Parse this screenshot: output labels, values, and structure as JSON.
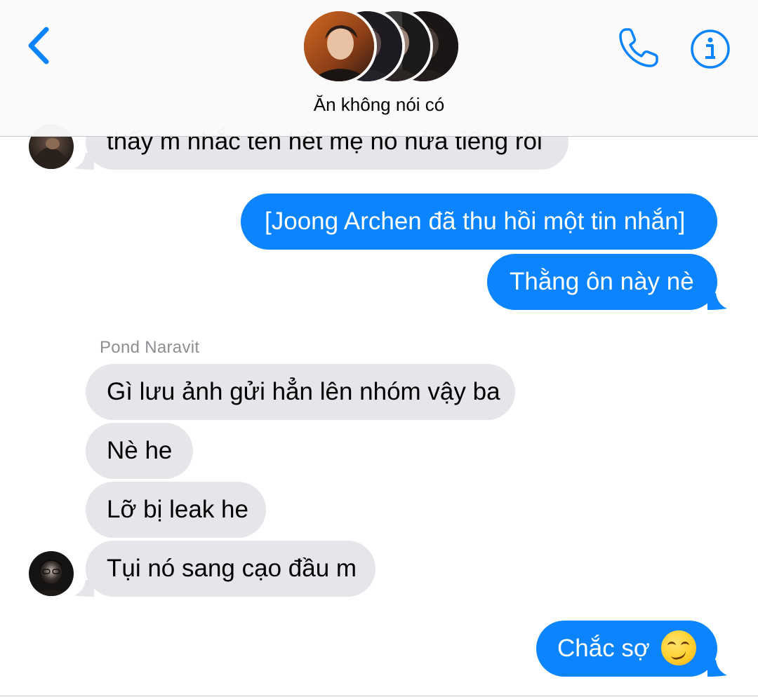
{
  "header": {
    "title": "Ăn không nói có",
    "accent_color": "#0b84fe",
    "icons": {
      "back": "chevron-left-icon",
      "call": "phone-icon",
      "info": "info-icon"
    }
  },
  "messages": [
    {
      "direction": "incoming",
      "text": "thấy m nhắc tên hết mẹ nó nửa tiếng rồi"
    },
    {
      "direction": "outgoing",
      "text": "[Joong Archen đã thu hồi một tin nhắn]"
    },
    {
      "direction": "outgoing",
      "text": "Thằng ôn này nè"
    },
    {
      "direction": "incoming",
      "sender": "Pond Naravit",
      "text": "Gì lưu ảnh gửi hẳn lên nhóm vậy ba"
    },
    {
      "direction": "incoming",
      "text": "Nè he"
    },
    {
      "direction": "incoming",
      "text": "Lỡ bị leak he"
    },
    {
      "direction": "incoming",
      "text": "Tụi nó sang cạo đầu m"
    },
    {
      "direction": "outgoing",
      "text": "Chắc sợ",
      "emoji": "smirking-face-emoji"
    }
  ],
  "colors": {
    "outgoing_bubble": "#0b84fe",
    "incoming_bubble": "#e5e5ea",
    "sender_name": "#8e8e93"
  }
}
